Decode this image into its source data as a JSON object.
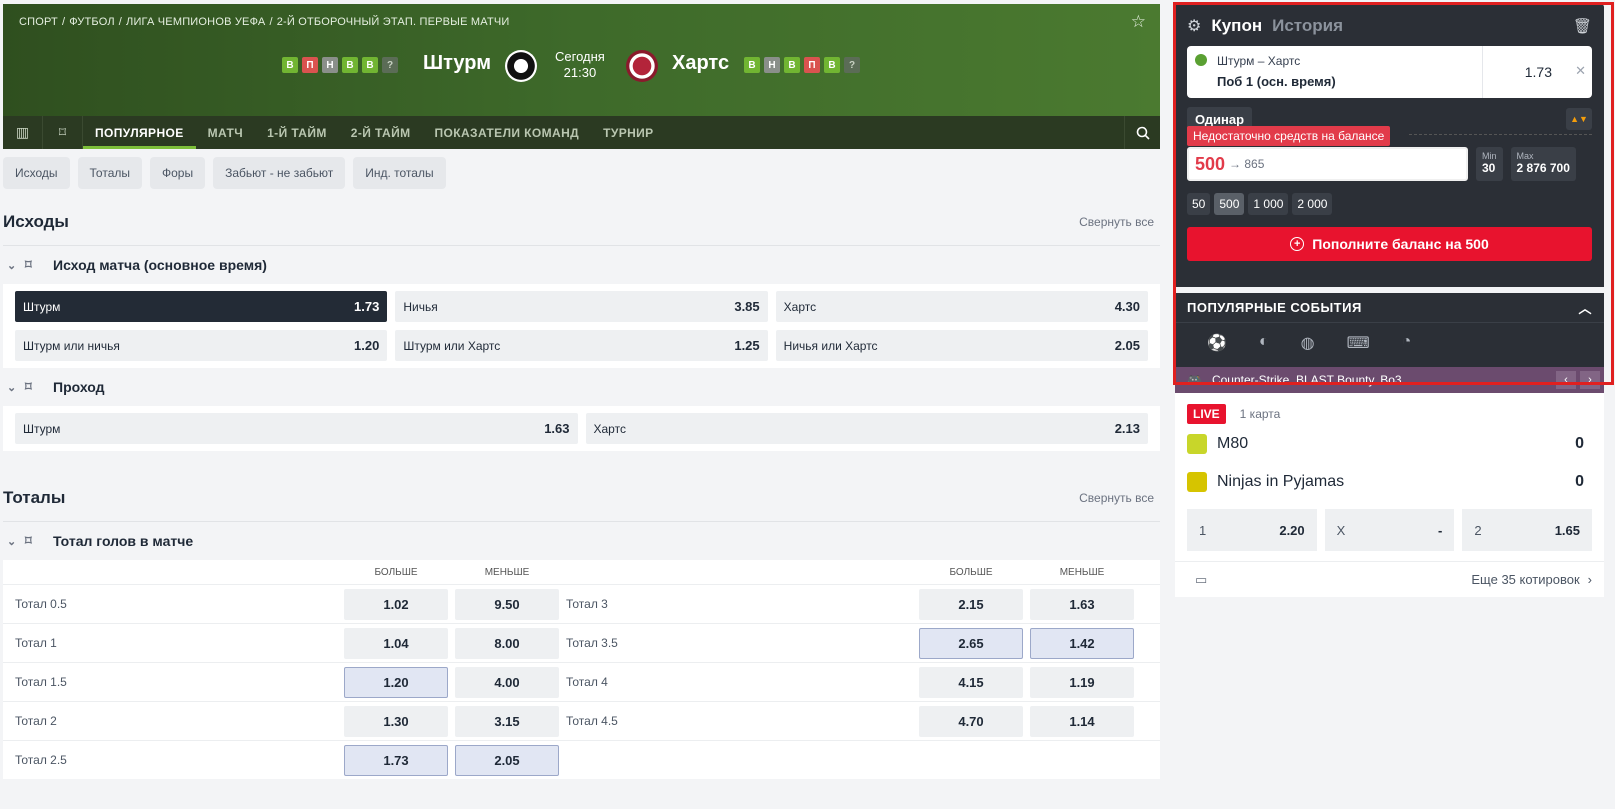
{
  "breadcrumbs": [
    "СПОРТ",
    "/",
    "ФУТБОЛ",
    "/",
    "ЛИГА ЧЕМПИОНОВ УЕФА",
    "/",
    "2-Й ОТБОРОЧНЫЙ ЭТАП. ПЕРВЫЕ МАТЧИ"
  ],
  "match": {
    "home": "Штурм",
    "away": "Хартс",
    "day": "Сегодня",
    "time": "21:30",
    "home_form": [
      "В",
      "П",
      "Н",
      "В",
      "В",
      "?"
    ],
    "away_form": [
      "В",
      "Н",
      "В",
      "П",
      "В",
      "?"
    ]
  },
  "tabs": [
    "ПОПУЛЯРНОЕ",
    "МАТЧ",
    "1-Й ТАЙМ",
    "2-Й ТАЙМ",
    "ПОКАЗАТЕЛИ КОМАНД",
    "ТУРНИР"
  ],
  "chips": [
    "Исходы",
    "Тоталы",
    "Форы",
    "Забьют - не забьют",
    "Инд. тоталы"
  ],
  "sections": {
    "outcomes_title": "Исходы",
    "totals_title": "Тоталы",
    "collapse": "Свернуть все"
  },
  "market1": {
    "title": "Исход матча (основное время)",
    "odds": [
      {
        "label": "Штурм",
        "value": "1.73"
      },
      {
        "label": "Ничья",
        "value": "3.85"
      },
      {
        "label": "Хартс",
        "value": "4.30"
      },
      {
        "label": "Штурм или ничья",
        "value": "1.20"
      },
      {
        "label": "Штурм или Хартс",
        "value": "1.25"
      },
      {
        "label": "Ничья или Хартс",
        "value": "2.05"
      }
    ]
  },
  "market2": {
    "title": "Проход",
    "odds": [
      {
        "label": "Штурм",
        "value": "1.63"
      },
      {
        "label": "Хартс",
        "value": "2.13"
      }
    ]
  },
  "market3": {
    "title": "Тотал голов в матче",
    "over": "БОЛЬШЕ",
    "under": "МЕНЬШЕ",
    "rows": [
      {
        "l": "Тотал 0.5",
        "o": "1.02",
        "u": "9.50",
        "l2": "Тотал 3",
        "o2": "2.15",
        "u2": "1.63"
      },
      {
        "l": "Тотал 1",
        "o": "1.04",
        "u": "8.00",
        "l2": "Тотал 3.5",
        "o2": "2.65",
        "u2": "1.42"
      },
      {
        "l": "Тотал 1.5",
        "o": "1.20",
        "u": "4.00",
        "l2": "Тотал 4",
        "o2": "4.15",
        "u2": "1.19"
      },
      {
        "l": "Тотал 2",
        "o": "1.30",
        "u": "3.15",
        "l2": "Тотал 4.5",
        "o2": "4.70",
        "u2": "1.14"
      },
      {
        "l": "Тотал 2.5",
        "o": "1.73",
        "u": "2.05",
        "l2": "",
        "o2": "",
        "u2": ""
      }
    ]
  },
  "coupon": {
    "title": "Купон",
    "history": "История",
    "bet_match": "Штурм – Хартс",
    "bet_outcome": "Поб 1 (осн. время)",
    "bet_odd": "1.73",
    "type": "Одинар",
    "warning": "Недостаточно средств на балансе",
    "stake": "500",
    "payout": "→ 865",
    "min_label": "Min",
    "min_value": "30",
    "max_label": "Max",
    "max_value": "2 876 700",
    "quick": [
      "50",
      "500",
      "1 000",
      "2 000"
    ],
    "topup": "Пополните баланс на 500"
  },
  "popular": {
    "title": "ПОПУЛЯРНЫЕ СОБЫТИЯ",
    "sports_icons": [
      "soccer-ball-icon",
      "tennis-ball-icon",
      "basketball-icon",
      "gamepad-icon",
      "table-tennis-icon"
    ]
  },
  "esports": {
    "title": "Counter-Strike. BLAST Bounty. Bo3",
    "live": "LIVE",
    "map": "1 карта",
    "team1": "M80",
    "score1": "0",
    "team2": "Ninjas in Pyjamas",
    "score2": "0",
    "odds": [
      {
        "label": "1",
        "value": "2.20"
      },
      {
        "label": "X",
        "value": "-"
      },
      {
        "label": "2",
        "value": "1.65"
      }
    ],
    "more": "Еще 35 котировок"
  }
}
